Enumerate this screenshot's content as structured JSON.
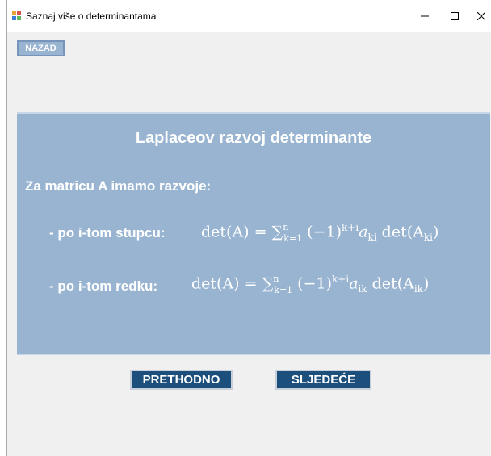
{
  "window": {
    "title": "Saznaj više o determinantama",
    "controls": {
      "minimize": "minimize-icon",
      "maximize": "maximize-icon",
      "close": "close-icon"
    }
  },
  "toolbar": {
    "back_label": "NAZAD"
  },
  "panel": {
    "title": "Laplaceov razvoj determinante",
    "intro": "Za matricu A imamo razvoje:",
    "row1_label": "- po i-tom stupcu:",
    "row2_label": "- po i-tom redku:",
    "row1_formula": {
      "lhs": "det(A) =",
      "sum_upper": "n",
      "sum_lower": "k=1",
      "term": "(−1)",
      "exp": "k+i",
      "a": "a",
      "a_sub": "ki",
      "det": "det(A",
      "det_sub": "ki",
      "close": ")"
    },
    "row2_formula": {
      "lhs": "det(A) =",
      "sum_upper": "n",
      "sum_lower": "k=1",
      "term": "(−1)",
      "exp": "k+i",
      "a": "a",
      "a_sub": "ik",
      "det": "det(A",
      "det_sub": "ik",
      "close": ")"
    }
  },
  "navigation": {
    "prev_label": "PRETHODNO",
    "next_label": "SLJEDEĆE"
  },
  "colors": {
    "panel_bg": "#99b4d1",
    "nav_button_bg": "#1d4f7c",
    "text_on_panel": "#ffffff"
  }
}
